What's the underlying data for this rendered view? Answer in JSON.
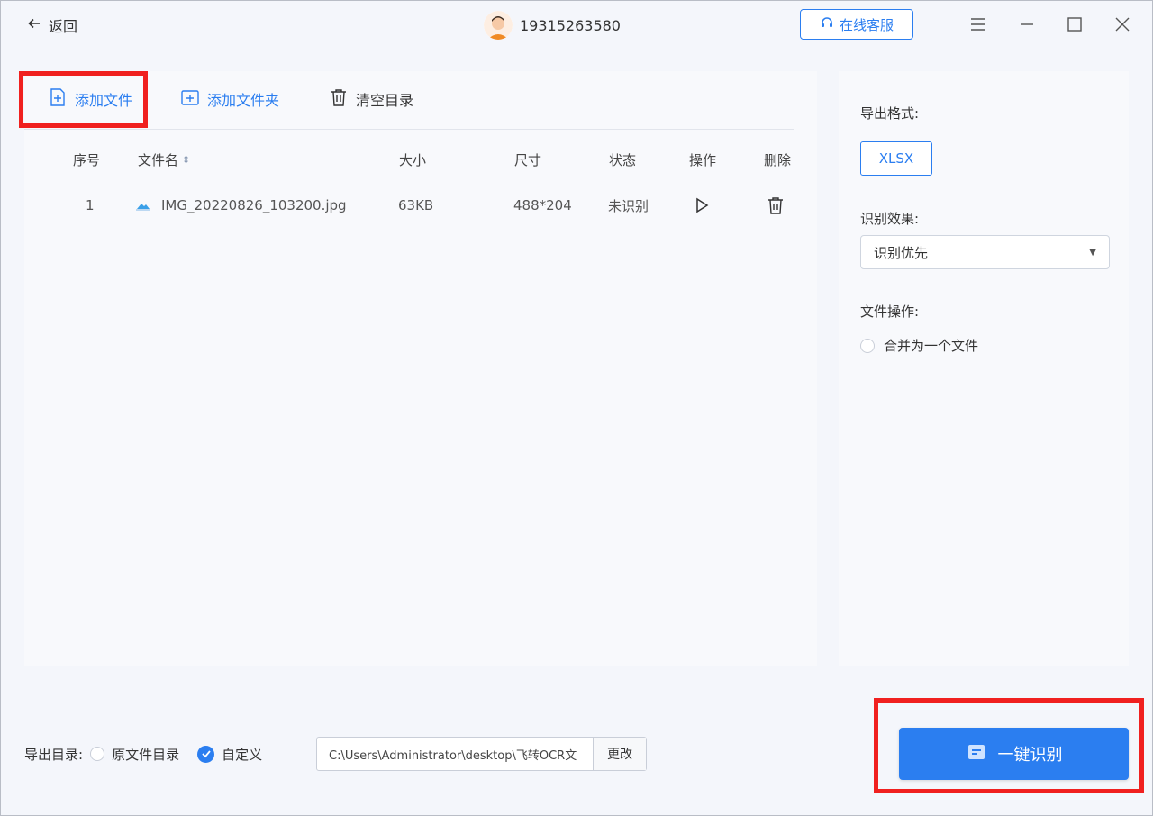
{
  "titlebar": {
    "back_label": "返回",
    "phone": "19315263580",
    "service_label": "在线客服",
    "icons": [
      "menu-icon",
      "minimize-icon",
      "maximize-icon",
      "close-icon"
    ]
  },
  "toolbar": {
    "add_file": "添加文件",
    "add_folder": "添加文件夹",
    "clear_list": "清空目录"
  },
  "table": {
    "headers": {
      "index": "序号",
      "filename": "文件名",
      "size": "大小",
      "dimensions": "尺寸",
      "status": "状态",
      "action": "操作",
      "delete": "删除"
    },
    "rows": [
      {
        "index": "1",
        "filename": "IMG_20220826_103200.jpg",
        "size": "63KB",
        "dimensions": "488*204",
        "status": "未识别"
      }
    ]
  },
  "side": {
    "export_format_label": "导出格式:",
    "format_value": "XLSX",
    "effect_label": "识别效果:",
    "effect_value": "识别优先",
    "file_op_label": "文件操作:",
    "merge_label": "合并为一个文件"
  },
  "bottom": {
    "export_dir_label": "导出目录:",
    "option_original": "原文件目录",
    "option_custom": "自定义",
    "custom_selected": true,
    "path_value": "C:\\Users\\Administrator\\desktop\\飞转OCR文",
    "change_label": "更改",
    "recognize_label": "一键识别"
  },
  "colors": {
    "accent": "#2b7ef0",
    "highlight": "#f0201f",
    "panel": "#f8f9fc",
    "background": "#f4f6fb"
  }
}
